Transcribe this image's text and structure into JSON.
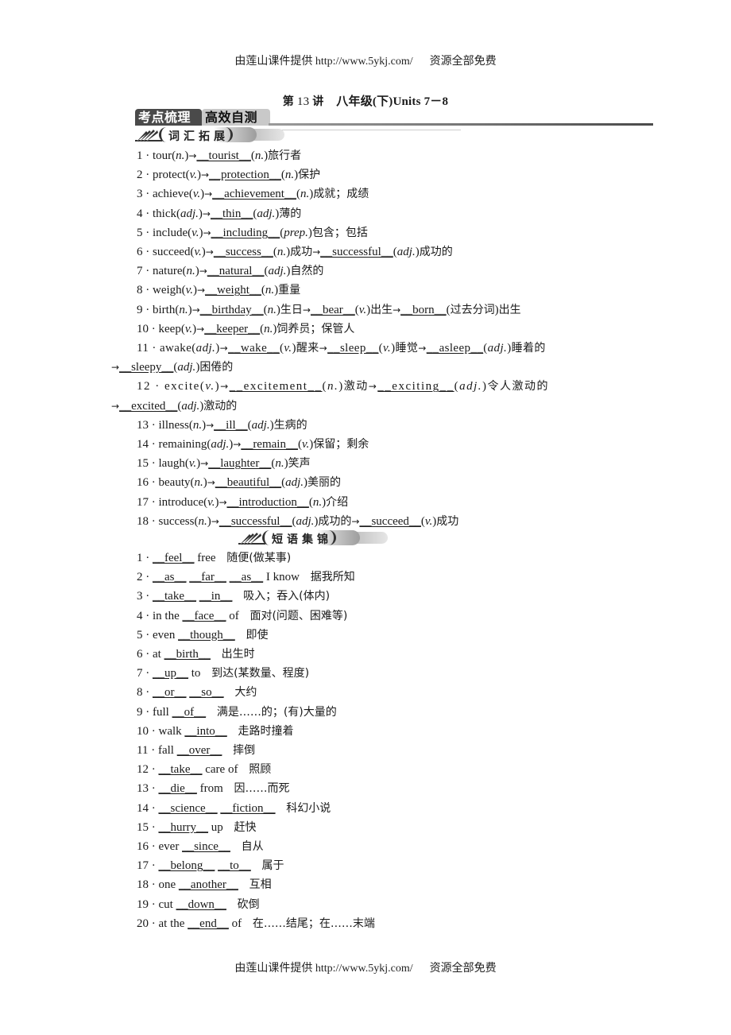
{
  "header": {
    "provider": "由莲山课件提供",
    "url": "http://www.5ykj.com/",
    "note": "资源全部免费"
  },
  "footer": {
    "provider": "由莲山课件提供",
    "url": "http://www.5ykj.com/",
    "note": "资源全部免费"
  },
  "lesson": {
    "prefix": "第",
    "number": "13",
    "suffix": "讲",
    "grade": "八年级(下)Units 7－8"
  },
  "banner": {
    "tab_dark": "考点梳理",
    "tab_light": "高效自测"
  },
  "vocab": {
    "title": "词汇拓展",
    "arrow": "→",
    "items": [
      {
        "num": "1",
        "base": "tour",
        "pos": "n.",
        "parts": [
          {
            "answer": "tourist",
            "pos": "n.",
            "meaning": "旅行者"
          }
        ]
      },
      {
        "num": "2",
        "base": "protect",
        "pos": "v.",
        "parts": [
          {
            "answer": "protection",
            "pos": "n.",
            "meaning": "保护"
          }
        ]
      },
      {
        "num": "3",
        "base": "achieve",
        "pos": "v.",
        "parts": [
          {
            "answer": "achievement",
            "pos": "n.",
            "meaning": "成就；成绩"
          }
        ]
      },
      {
        "num": "4",
        "base": "thick",
        "pos": "adj.",
        "parts": [
          {
            "answer": "thin",
            "pos": "adj.",
            "meaning": "薄的"
          }
        ]
      },
      {
        "num": "5",
        "base": "include",
        "pos": "v.",
        "parts": [
          {
            "answer": "including",
            "pos": "prep.",
            "meaning": "包含；包括"
          }
        ]
      },
      {
        "num": "6",
        "base": "succeed",
        "pos": "v.",
        "parts": [
          {
            "answer": "success",
            "pos": "n.",
            "meaning": "成功"
          },
          {
            "answer": "successful",
            "pos": "adj.",
            "meaning": "成功的"
          }
        ]
      },
      {
        "num": "7",
        "base": "nature",
        "pos": "n.",
        "parts": [
          {
            "answer": "natural",
            "pos": "adj.",
            "meaning": "自然的"
          }
        ]
      },
      {
        "num": "8",
        "base": "weigh",
        "pos": "v.",
        "parts": [
          {
            "answer": "weight",
            "pos": "n.",
            "meaning": "重量"
          }
        ]
      },
      {
        "num": "9",
        "base": "birth",
        "pos": "n.",
        "parts": [
          {
            "answer": "birthday",
            "pos": "n.",
            "meaning": "生日"
          },
          {
            "answer": "bear",
            "pos": "v.",
            "meaning": "出生"
          },
          {
            "answer": "born",
            "pos": "过去分词",
            "meaning": "出生"
          }
        ]
      },
      {
        "num": "10",
        "base": "keep",
        "pos": "v.",
        "parts": [
          {
            "answer": "keeper",
            "pos": "n.",
            "meaning": "饲养员；保管人"
          }
        ]
      },
      {
        "num": "11",
        "base": "awake",
        "pos": "adj.",
        "parts": [
          {
            "answer": "wake",
            "pos": "v.",
            "meaning": "醒来"
          },
          {
            "answer": "sleep",
            "pos": "v.",
            "meaning": "睡觉"
          },
          {
            "answer": "asleep",
            "pos": "adj.",
            "meaning": "睡着的"
          },
          {
            "answer": "sleepy",
            "pos": "adj.",
            "meaning": "困倦的"
          }
        ]
      },
      {
        "num": "12",
        "base": "excite",
        "pos": "v.",
        "parts": [
          {
            "answer": "excitement",
            "pos": "n.",
            "meaning": "激动"
          },
          {
            "answer": "exciting",
            "pos": "adj.",
            "meaning": "令人激动的"
          },
          {
            "answer": "excited",
            "pos": "adj.",
            "meaning": "激动的"
          }
        ]
      },
      {
        "num": "13",
        "base": "illness",
        "pos": "n.",
        "parts": [
          {
            "answer": "ill",
            "pos": "adj.",
            "meaning": "生病的"
          }
        ]
      },
      {
        "num": "14",
        "base": "remaining",
        "pos": "adj.",
        "parts": [
          {
            "answer": "remain",
            "pos": "v.",
            "meaning": "保留；剩余"
          }
        ]
      },
      {
        "num": "15",
        "base": "laugh",
        "pos": "v.",
        "parts": [
          {
            "answer": "laughter",
            "pos": "n.",
            "meaning": "笑声"
          }
        ]
      },
      {
        "num": "16",
        "base": "beauty",
        "pos": "n.",
        "parts": [
          {
            "answer": "beautiful",
            "pos": "adj.",
            "meaning": "美丽的"
          }
        ]
      },
      {
        "num": "17",
        "base": "introduce",
        "pos": "v.",
        "parts": [
          {
            "answer": "introduction",
            "pos": "n.",
            "meaning": "介绍"
          }
        ]
      },
      {
        "num": "18",
        "base": "success",
        "pos": "n.",
        "parts": [
          {
            "answer": "successful",
            "pos": "adj.",
            "meaning": "成功的"
          },
          {
            "answer": "succeed",
            "pos": "v.",
            "meaning": "成功"
          }
        ]
      }
    ]
  },
  "phrases": {
    "title": "短语集锦",
    "items": [
      {
        "num": "1",
        "segments": [
          {
            "blank": "feel"
          },
          {
            "text": "free"
          }
        ],
        "meaning": "随便(做某事)"
      },
      {
        "num": "2",
        "segments": [
          {
            "blank": "as"
          },
          {
            "blank": "far"
          },
          {
            "blank": "as"
          },
          {
            "text": "I know"
          }
        ],
        "meaning": "据我所知"
      },
      {
        "num": "3",
        "segments": [
          {
            "blank": "take"
          },
          {
            "blank": "in"
          }
        ],
        "meaning": "吸入；吞入(体内)"
      },
      {
        "num": "4",
        "segments": [
          {
            "text": "in the"
          },
          {
            "blank": "face"
          },
          {
            "text": "of"
          }
        ],
        "meaning": "面对(问题、困难等)"
      },
      {
        "num": "5",
        "segments": [
          {
            "text": "even"
          },
          {
            "blank": "though"
          }
        ],
        "meaning": "即使"
      },
      {
        "num": "6",
        "segments": [
          {
            "text": "at"
          },
          {
            "blank": "birth"
          }
        ],
        "meaning": "出生时"
      },
      {
        "num": "7",
        "segments": [
          {
            "blank": "up"
          },
          {
            "text": "to"
          }
        ],
        "meaning": "到达(某数量、程度)"
      },
      {
        "num": "8",
        "segments": [
          {
            "blank": "or"
          },
          {
            "blank": "so"
          }
        ],
        "meaning": "大约"
      },
      {
        "num": "9",
        "segments": [
          {
            "text": "full"
          },
          {
            "blank": "of"
          }
        ],
        "meaning": "满是……的；(有)大量的"
      },
      {
        "num": "10",
        "segments": [
          {
            "text": "walk"
          },
          {
            "blank": "into"
          }
        ],
        "meaning": "走路时撞着"
      },
      {
        "num": "11",
        "segments": [
          {
            "text": "fall"
          },
          {
            "blank": "over"
          }
        ],
        "meaning": "摔倒"
      },
      {
        "num": "12",
        "segments": [
          {
            "blank": "take"
          },
          {
            "text": "care of"
          }
        ],
        "meaning": "照顾"
      },
      {
        "num": "13",
        "segments": [
          {
            "blank": "die"
          },
          {
            "text": "from"
          }
        ],
        "meaning": "因……而死"
      },
      {
        "num": "14",
        "segments": [
          {
            "blank": "science"
          },
          {
            "blank": "fiction"
          }
        ],
        "meaning": "科幻小说"
      },
      {
        "num": "15",
        "segments": [
          {
            "blank": "hurry"
          },
          {
            "text": "up"
          }
        ],
        "meaning": "赶快"
      },
      {
        "num": "16",
        "segments": [
          {
            "text": "ever"
          },
          {
            "blank": "since"
          }
        ],
        "meaning": "自从"
      },
      {
        "num": "17",
        "segments": [
          {
            "blank": "belong"
          },
          {
            "blank": "to"
          }
        ],
        "meaning": "属于"
      },
      {
        "num": "18",
        "segments": [
          {
            "text": "one"
          },
          {
            "blank": "another"
          }
        ],
        "meaning": "互相"
      },
      {
        "num": "19",
        "segments": [
          {
            "text": "cut"
          },
          {
            "blank": "down"
          }
        ],
        "meaning": "砍倒"
      },
      {
        "num": "20",
        "segments": [
          {
            "text": "at the"
          },
          {
            "blank": "end"
          },
          {
            "text": "of"
          }
        ],
        "meaning": "在……结尾；在……末端"
      }
    ]
  }
}
